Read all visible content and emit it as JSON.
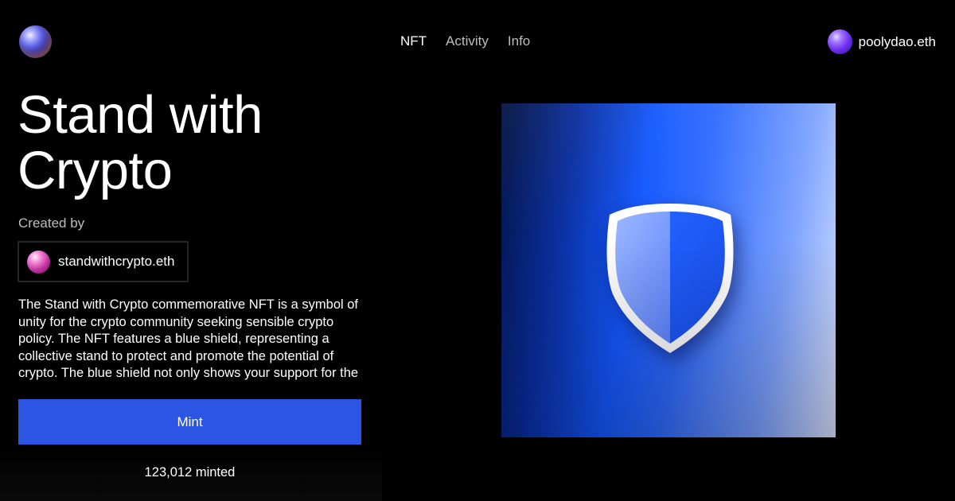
{
  "header": {
    "logo_icon": "gradient-orb-logo",
    "nav": [
      {
        "label": "NFT",
        "active": true
      },
      {
        "label": "Activity",
        "active": false
      },
      {
        "label": "Info",
        "active": false
      }
    ],
    "account": {
      "name": "poolydao.eth",
      "avatar": "purple-orb-avatar"
    }
  },
  "main": {
    "title": "Stand with Crypto",
    "created_by_label": "Created by",
    "creator": {
      "name": "standwithcrypto.eth",
      "avatar": "pink-orb-avatar"
    },
    "description": "The Stand with Crypto commemorative NFT is a symbol of unity for the crypto community seeking sensible crypto policy. The NFT features a blue shield, representing a collective stand to protect and promote the potential of crypto. The blue shield not only shows your support for the",
    "mint_button_label": "Mint",
    "minted_count": "123,012 minted"
  },
  "nft": {
    "image_icon": "shield-icon",
    "colors": {
      "accent": "#2c55e3",
      "shield_blue": "#1e5cff",
      "background": "#000000"
    }
  }
}
